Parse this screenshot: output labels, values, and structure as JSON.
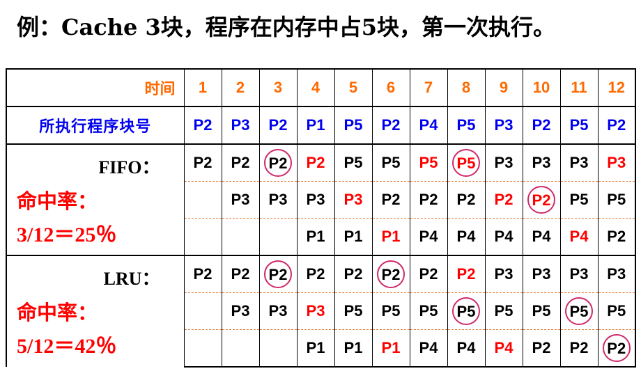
{
  "title": {
    "prefix": "例：",
    "text": "Cache 3块，程序在内存中占5块，第一次执行。"
  },
  "header": {
    "label": "时间",
    "times": [
      "1",
      "2",
      "3",
      "4",
      "5",
      "6",
      "7",
      "8",
      "9",
      "10",
      "11",
      "12"
    ]
  },
  "sequence": {
    "label": "所执行程序块号",
    "blocks": [
      "P2",
      "P3",
      "P2",
      "P1",
      "P5",
      "P2",
      "P4",
      "P5",
      "P3",
      "P2",
      "P5",
      "P2"
    ]
  },
  "fifo": {
    "name": "FIFO：",
    "rate_label": "命中率：",
    "rate_value": "3/12＝25％",
    "rows": [
      [
        {
          "v": "P2",
          "c": "k"
        },
        {
          "v": "P2",
          "c": "k"
        },
        {
          "v": "P2",
          "c": "k",
          "hit": true
        },
        {
          "v": "P2",
          "c": "r"
        },
        {
          "v": "P5",
          "c": "k"
        },
        {
          "v": "P5",
          "c": "k"
        },
        {
          "v": "P5",
          "c": "r"
        },
        {
          "v": "P5",
          "c": "r",
          "hit": true
        },
        {
          "v": "P3",
          "c": "k"
        },
        {
          "v": "P3",
          "c": "k"
        },
        {
          "v": "P3",
          "c": "k"
        },
        {
          "v": "P3",
          "c": "r"
        }
      ],
      [
        {
          "v": "",
          "c": "k"
        },
        {
          "v": "P3",
          "c": "k"
        },
        {
          "v": "P3",
          "c": "k"
        },
        {
          "v": "P3",
          "c": "k"
        },
        {
          "v": "P3",
          "c": "r"
        },
        {
          "v": "P2",
          "c": "k"
        },
        {
          "v": "P2",
          "c": "k"
        },
        {
          "v": "P2",
          "c": "k"
        },
        {
          "v": "P2",
          "c": "r"
        },
        {
          "v": "P2",
          "c": "r",
          "hit": true
        },
        {
          "v": "P5",
          "c": "k"
        },
        {
          "v": "P5",
          "c": "k"
        }
      ],
      [
        {
          "v": "",
          "c": "k"
        },
        {
          "v": "",
          "c": "k"
        },
        {
          "v": "",
          "c": "k"
        },
        {
          "v": "P1",
          "c": "k"
        },
        {
          "v": "P1",
          "c": "k"
        },
        {
          "v": "P1",
          "c": "r"
        },
        {
          "v": "P4",
          "c": "k"
        },
        {
          "v": "P4",
          "c": "k"
        },
        {
          "v": "P4",
          "c": "k"
        },
        {
          "v": "P4",
          "c": "k"
        },
        {
          "v": "P4",
          "c": "r"
        },
        {
          "v": "P2",
          "c": "k"
        }
      ]
    ]
  },
  "lru": {
    "name": "LRU：",
    "rate_label": "命中率：",
    "rate_value": "5/12＝42％",
    "rows": [
      [
        {
          "v": "P2",
          "c": "k"
        },
        {
          "v": "P2",
          "c": "k"
        },
        {
          "v": "P2",
          "c": "k",
          "hit": true
        },
        {
          "v": "P2",
          "c": "k"
        },
        {
          "v": "P2",
          "c": "k"
        },
        {
          "v": "P2",
          "c": "k",
          "hit": true
        },
        {
          "v": "P2",
          "c": "k"
        },
        {
          "v": "P2",
          "c": "r"
        },
        {
          "v": "P3",
          "c": "k"
        },
        {
          "v": "P3",
          "c": "k"
        },
        {
          "v": "P3",
          "c": "k"
        },
        {
          "v": "P3",
          "c": "k"
        }
      ],
      [
        {
          "v": "",
          "c": "k"
        },
        {
          "v": "P3",
          "c": "k"
        },
        {
          "v": "P3",
          "c": "k"
        },
        {
          "v": "P3",
          "c": "r"
        },
        {
          "v": "P5",
          "c": "k"
        },
        {
          "v": "P5",
          "c": "k"
        },
        {
          "v": "P5",
          "c": "k"
        },
        {
          "v": "P5",
          "c": "k",
          "hit": true
        },
        {
          "v": "P5",
          "c": "k"
        },
        {
          "v": "P5",
          "c": "k"
        },
        {
          "v": "P5",
          "c": "k",
          "hit": true
        },
        {
          "v": "P5",
          "c": "k"
        }
      ],
      [
        {
          "v": "",
          "c": "k"
        },
        {
          "v": "",
          "c": "k"
        },
        {
          "v": "",
          "c": "k"
        },
        {
          "v": "P1",
          "c": "k"
        },
        {
          "v": "P1",
          "c": "k"
        },
        {
          "v": "P1",
          "c": "r"
        },
        {
          "v": "P4",
          "c": "k"
        },
        {
          "v": "P4",
          "c": "k"
        },
        {
          "v": "P4",
          "c": "r"
        },
        {
          "v": "P2",
          "c": "k"
        },
        {
          "v": "P2",
          "c": "k"
        },
        {
          "v": "P2",
          "c": "k",
          "hit": true
        }
      ]
    ]
  },
  "colors": {
    "header": "#ff6a00",
    "sequence": "#0000ee",
    "miss_highlight": "#ff0000",
    "hit_circle": "#d0286a"
  }
}
